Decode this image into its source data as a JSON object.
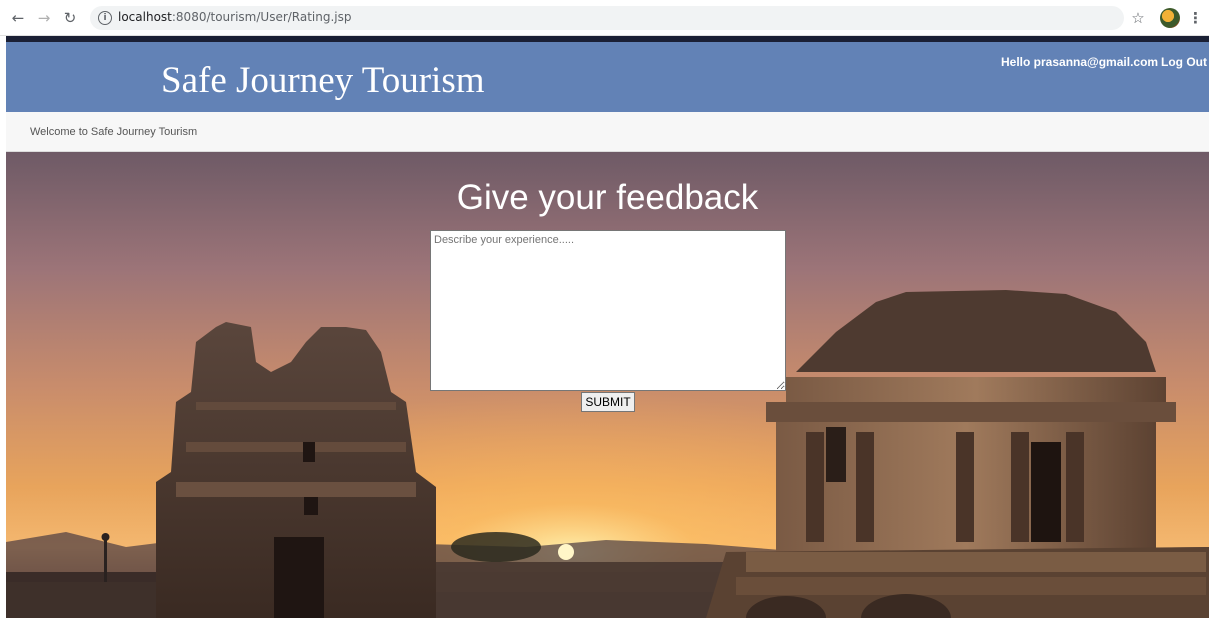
{
  "browser": {
    "url_host": "localhost",
    "url_path": ":8080/tourism/User/Rating.jsp"
  },
  "header": {
    "site_title": "Safe Journey Tourism",
    "user_greeting": "Hello prasanna@gmail.com",
    "logout_label": "Log Out"
  },
  "welcome_bar": {
    "text": "Welcome to Safe Journey Tourism"
  },
  "feedback": {
    "heading": "Give your feedback",
    "placeholder": "Describe your experience.....",
    "value": "",
    "submit_label": "SUBMIT"
  },
  "colors": {
    "header_bg": "#6282b6",
    "header_top_strip": "#1b2035",
    "welcome_bg": "#f7f7f7"
  },
  "icons": {
    "back": "back-arrow-icon",
    "forward": "forward-arrow-icon",
    "reload": "reload-icon",
    "site_info": "info-icon",
    "bookmark": "star-icon",
    "profile": "avatar",
    "menu": "kebab-menu-icon"
  }
}
